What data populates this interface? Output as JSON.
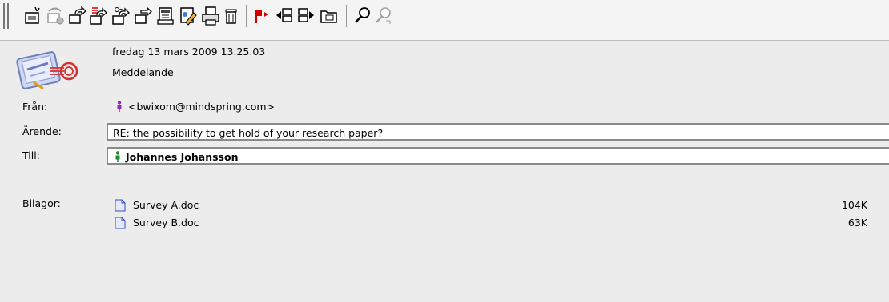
{
  "toolbar": {
    "buttons": [
      {
        "name": "new-message-icon"
      },
      {
        "name": "get-mail-icon"
      },
      {
        "name": "reply-icon"
      },
      {
        "name": "reply-all-icon"
      },
      {
        "name": "reply-list-icon"
      },
      {
        "name": "forward-icon"
      },
      {
        "name": "redirect-icon"
      },
      {
        "name": "edit-message-icon"
      },
      {
        "name": "print-icon"
      },
      {
        "name": "trash-icon"
      },
      {
        "name": "flag-icon"
      },
      {
        "name": "previous-message-icon"
      },
      {
        "name": "next-message-icon"
      },
      {
        "name": "file-folder-icon"
      },
      {
        "name": "find-icon"
      },
      {
        "name": "find-again-icon"
      }
    ]
  },
  "message": {
    "date": "fredag 13 mars 2009 13.25.03",
    "type": "Meddelande",
    "from_label": "Från:",
    "from_value": "<bwixom@mindspring.com>",
    "subject_label": "Ärende:",
    "subject_value": "RE: the possibility to get hold of your research paper?",
    "to_label": "Till:",
    "to_value": "Johannes Johansson",
    "attachments_label": "Bilagor:",
    "attachments": [
      {
        "name": "Survey A.doc",
        "size": "104K"
      },
      {
        "name": "Survey B.doc",
        "size": "63K"
      }
    ]
  },
  "colors": {
    "from_person": "#8a2fb0",
    "to_person": "#1f8a2a",
    "flag": "#d40000"
  }
}
